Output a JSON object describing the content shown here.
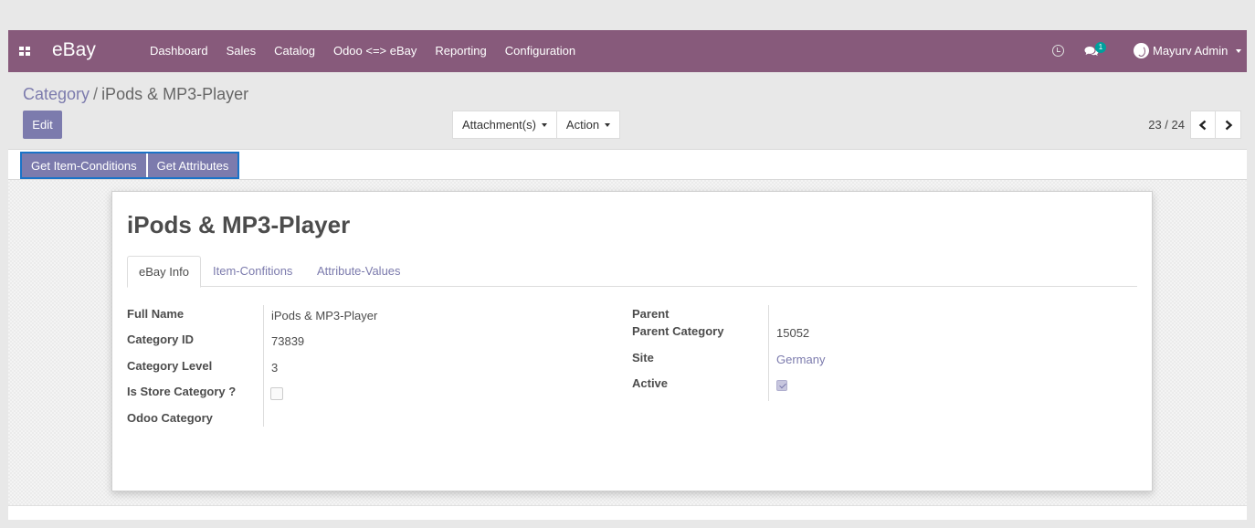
{
  "navbar": {
    "brand": "eBay",
    "menu": [
      "Dashboard",
      "Sales",
      "Catalog",
      "Odoo <=> eBay",
      "Reporting",
      "Configuration"
    ],
    "chat_badge": "1",
    "user_name": "Mayurv Admin",
    "color": "#875a7b"
  },
  "breadcrumb": {
    "parent": "Category",
    "separator": "/",
    "current": "iPods & MP3-Player"
  },
  "control_panel": {
    "edit_label": "Edit",
    "attachments_label": "Attachment(s)",
    "action_label": "Action",
    "pager": "23 / 24"
  },
  "header_buttons": {
    "item_conditions": "Get Item-Conditions",
    "attributes": "Get Attributes"
  },
  "record": {
    "title": "iPods & MP3-Player",
    "tabs": [
      "eBay Info",
      "Item-Confitions",
      "Attribute-Values"
    ],
    "left_fields": {
      "full_name_label": "Full Name",
      "full_name": "iPods & MP3-Player",
      "category_id_label": "Category ID",
      "category_id": "73839",
      "category_level_label": "Category Level",
      "category_level": "3",
      "is_store_label": "Is Store Category ?",
      "is_store": false,
      "odoo_category_label": "Odoo Category"
    },
    "right_fields": {
      "parent_label": "Parent",
      "parent_category_label": "Parent Category",
      "parent_category": "15052",
      "site_label": "Site",
      "site": "Germany",
      "active_label": "Active",
      "active": true
    }
  },
  "colors": {
    "accent": "#7c7bad",
    "highlight_border": "#1a73c7"
  }
}
